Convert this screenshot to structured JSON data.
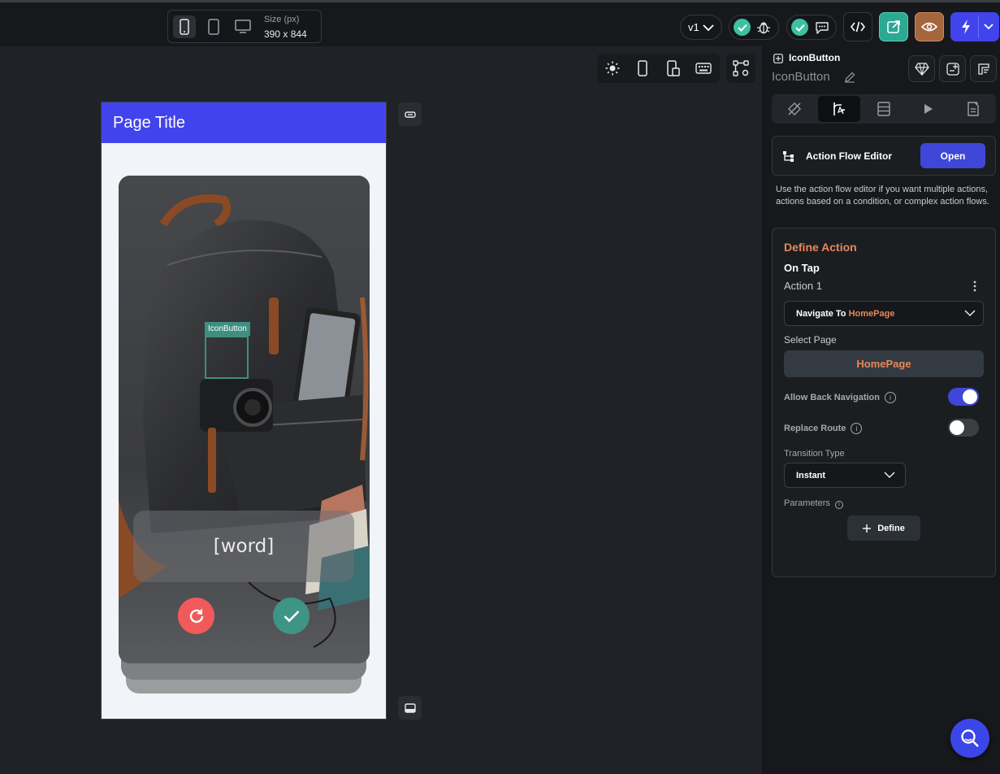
{
  "topbar": {
    "size_label": "Size (px)",
    "size_value": "390 x 844",
    "version": "v1",
    "devices": [
      "phone",
      "tablet",
      "desktop"
    ]
  },
  "canvas": {
    "page_title": "Page Title",
    "word": "[word]",
    "selection_label": "IconButton"
  },
  "panel": {
    "component_type": "IconButton",
    "component_name": "IconButton",
    "action_flow_editor": {
      "label": "Action Flow Editor",
      "open_label": "Open",
      "description": "Use the action flow editor if you want multiple actions, actions based on a condition, or complex action flows."
    },
    "define_action": {
      "title": "Define Action",
      "trigger": "On Tap",
      "action_name": "Action 1",
      "action_type": "Navigate To",
      "action_target": "HomePage",
      "select_page_label": "Select Page",
      "selected_page": "HomePage",
      "allow_back_label": "Allow Back Navigation",
      "allow_back_enabled": true,
      "replace_route_label": "Replace Route",
      "replace_route_enabled": false,
      "transition_type_label": "Transition Type",
      "transition_type_value": "Instant",
      "parameters_label": "Parameters",
      "define_button": "Define"
    }
  },
  "colors": {
    "accent": "#4144ec",
    "orange": "#e8875a",
    "teal": "#3ec1a0",
    "red_button": "#f15a5a",
    "green_button": "#3e9585"
  }
}
